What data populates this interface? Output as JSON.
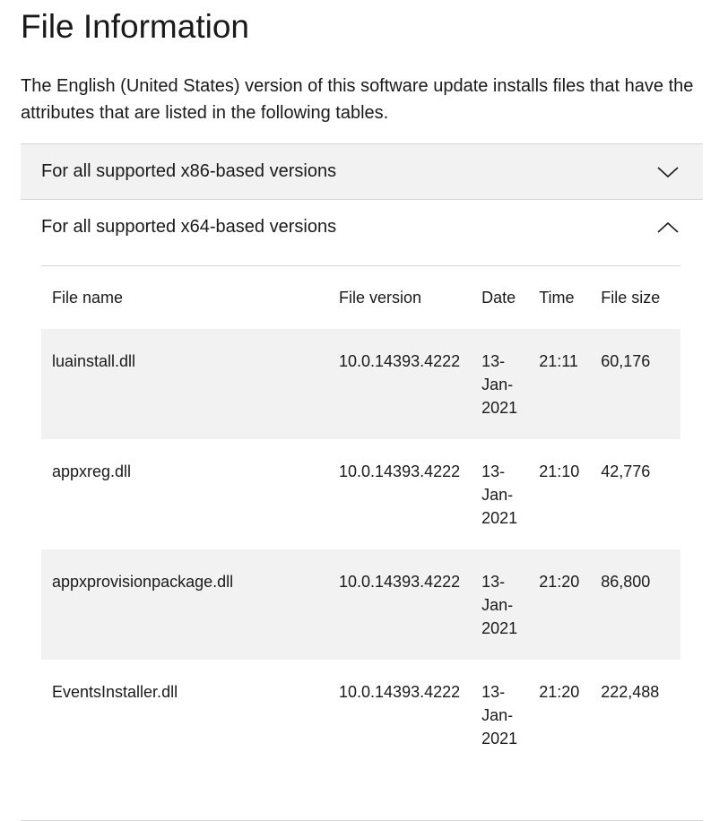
{
  "page": {
    "title": "File Information",
    "intro": "The English (United States) version of this software update installs files that have the attributes that are listed in the following tables."
  },
  "accordion": {
    "x86": {
      "label": "For all supported x86-based versions",
      "expanded": false,
      "icon": "chevron-down-icon"
    },
    "x64": {
      "label": "For all supported x64-based versions",
      "expanded": true,
      "icon": "chevron-up-icon"
    }
  },
  "table": {
    "headers": [
      "File name",
      "File version",
      "Date",
      "Time",
      "File size"
    ],
    "rows": [
      [
        "luainstall.dll",
        "10.0.14393.4222",
        "13-Jan-2021",
        "21:11",
        "60,176"
      ],
      [
        "appxreg.dll",
        "10.0.14393.4222",
        "13-Jan-2021",
        "21:10",
        "42,776"
      ],
      [
        "appxprovisionpackage.dll",
        "10.0.14393.4222",
        "13-Jan-2021",
        "21:20",
        "86,800"
      ],
      [
        "EventsInstaller.dll",
        "10.0.14393.4222",
        "13-Jan-2021",
        "21:20",
        "222,488"
      ]
    ]
  },
  "colors": {
    "row_alt": "#f2f2f2",
    "divider": "#d6d6d6",
    "text": "#1a1a1a"
  }
}
